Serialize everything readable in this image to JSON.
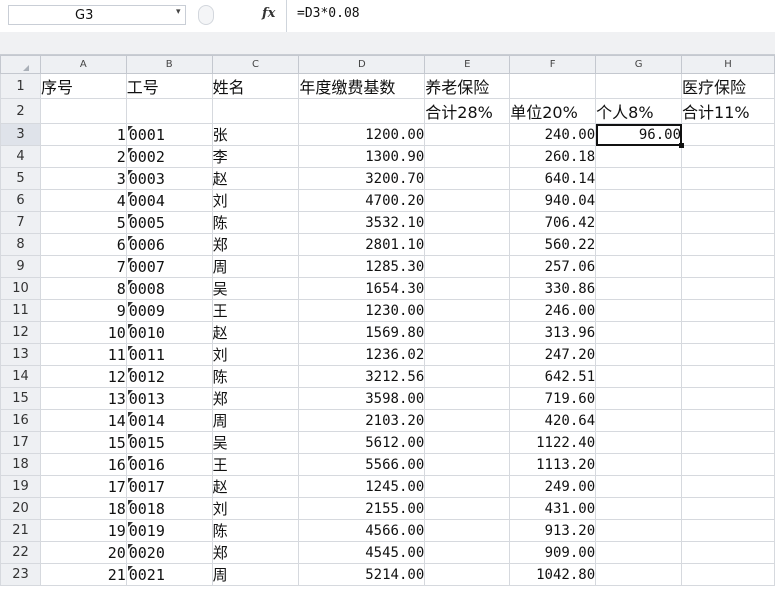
{
  "formula_bar": {
    "name_box": "G3",
    "name_box_arrow": "▾",
    "fx": "fx",
    "formula": "=D3*0.08"
  },
  "columns": [
    "A",
    "B",
    "C",
    "D",
    "E",
    "F",
    "G",
    "H"
  ],
  "selected_cell": "G3",
  "header_rows": [
    {
      "row": "1",
      "A": "序号",
      "B": "工号",
      "C": "姓名",
      "D": "年度缴费基数",
      "E": "养老保险",
      "F": "",
      "G": "",
      "H": "医疗保险"
    },
    {
      "row": "2",
      "A": "",
      "B": "",
      "C": "",
      "D": "",
      "E": "合计28%",
      "F": "单位20%",
      "G": "个人8%",
      "H": "合计11%"
    }
  ],
  "rows": [
    {
      "row": "3",
      "A": "1",
      "B": "0001",
      "C": "张",
      "D": "1200.00",
      "F": "240.00",
      "G": "96.00"
    },
    {
      "row": "4",
      "A": "2",
      "B": "0002",
      "C": "李",
      "D": "1300.90",
      "F": "260.18",
      "G": ""
    },
    {
      "row": "5",
      "A": "3",
      "B": "0003",
      "C": "赵",
      "D": "3200.70",
      "F": "640.14",
      "G": ""
    },
    {
      "row": "6",
      "A": "4",
      "B": "0004",
      "C": "刘",
      "D": "4700.20",
      "F": "940.04",
      "G": ""
    },
    {
      "row": "7",
      "A": "5",
      "B": "0005",
      "C": "陈",
      "D": "3532.10",
      "F": "706.42",
      "G": ""
    },
    {
      "row": "8",
      "A": "6",
      "B": "0006",
      "C": "郑",
      "D": "2801.10",
      "F": "560.22",
      "G": ""
    },
    {
      "row": "9",
      "A": "7",
      "B": "0007",
      "C": "周",
      "D": "1285.30",
      "F": "257.06",
      "G": ""
    },
    {
      "row": "10",
      "A": "8",
      "B": "0008",
      "C": "吴",
      "D": "1654.30",
      "F": "330.86",
      "G": ""
    },
    {
      "row": "11",
      "A": "9",
      "B": "0009",
      "C": "王",
      "D": "1230.00",
      "F": "246.00",
      "G": ""
    },
    {
      "row": "12",
      "A": "10",
      "B": "0010",
      "C": "赵",
      "D": "1569.80",
      "F": "313.96",
      "G": ""
    },
    {
      "row": "13",
      "A": "11",
      "B": "0011",
      "C": "刘",
      "D": "1236.02",
      "F": "247.20",
      "G": ""
    },
    {
      "row": "14",
      "A": "12",
      "B": "0012",
      "C": "陈",
      "D": "3212.56",
      "F": "642.51",
      "G": ""
    },
    {
      "row": "15",
      "A": "13",
      "B": "0013",
      "C": "郑",
      "D": "3598.00",
      "F": "719.60",
      "G": ""
    },
    {
      "row": "16",
      "A": "14",
      "B": "0014",
      "C": "周",
      "D": "2103.20",
      "F": "420.64",
      "G": ""
    },
    {
      "row": "17",
      "A": "15",
      "B": "0015",
      "C": "吴",
      "D": "5612.00",
      "F": "1122.40",
      "G": ""
    },
    {
      "row": "18",
      "A": "16",
      "B": "0016",
      "C": "王",
      "D": "5566.00",
      "F": "1113.20",
      "G": ""
    },
    {
      "row": "19",
      "A": "17",
      "B": "0017",
      "C": "赵",
      "D": "1245.00",
      "F": "249.00",
      "G": ""
    },
    {
      "row": "20",
      "A": "18",
      "B": "0018",
      "C": "刘",
      "D": "2155.00",
      "F": "431.00",
      "G": ""
    },
    {
      "row": "21",
      "A": "19",
      "B": "0019",
      "C": "陈",
      "D": "4566.00",
      "F": "913.20",
      "G": ""
    },
    {
      "row": "22",
      "A": "20",
      "B": "0020",
      "C": "郑",
      "D": "4545.00",
      "F": "909.00",
      "G": ""
    },
    {
      "row": "23",
      "A": "21",
      "B": "0021",
      "C": "周",
      "D": "5214.00",
      "F": "1042.80",
      "G": ""
    }
  ]
}
